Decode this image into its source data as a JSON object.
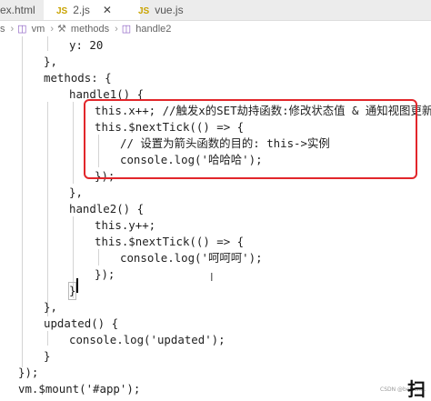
{
  "tabs": [
    {
      "label": "ex.html",
      "icon": "html-file-icon",
      "active": false
    },
    {
      "label": "2.js",
      "badge": "JS",
      "active": true
    },
    {
      "label": "vue.js",
      "badge": "JS",
      "active": false
    }
  ],
  "breadcrumb": [
    "s",
    "vm",
    "methods",
    "handle2"
  ],
  "code_lines": [
    "y: 20",
    "},",
    "methods: {",
    "handle1() {",
    "this.x++; //触发x的SET劫持函数:修改状态值 & 通知视图更新",
    "this.$nextTick(() => {",
    "// 设置为箭头函数的目的: this->实例",
    "console.log('哈哈哈');",
    "});",
    "},",
    "handle2() {",
    "this.y++;",
    "this.$nextTick(() => {",
    "console.log('呵呵呵');",
    "});",
    "}",
    "},",
    "updated() {",
    "console.log('updated');",
    "}",
    "});",
    "vm.$mount('#app');"
  ],
  "watermark": "CSDN @betten...",
  "corner_text": "扫"
}
